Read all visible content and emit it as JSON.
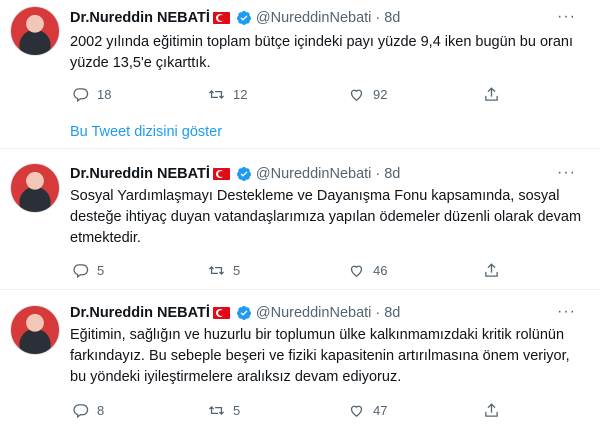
{
  "tweets": [
    {
      "name": "Dr.Nureddin NEBATİ",
      "handle": "@NureddinNebati",
      "time": "8d",
      "separator": "·",
      "more": "···",
      "text": "2002 yılında eğitimin toplam bütçe içindeki payı yüzde 9,4 iken bugün bu oranı yüzde 13,5'e çıkarttık.",
      "replies": "18",
      "retweets": "12",
      "likes": "92"
    },
    {
      "name": "Dr.Nureddin NEBATİ",
      "handle": "@NureddinNebati",
      "time": "8d",
      "separator": "·",
      "more": "···",
      "text": "Sosyal Yardımlaşmayı Destekleme ve Dayanışma Fonu kapsamında, sosyal desteğe ihtiyaç duyan vatandaşlarımıza yapılan ödemeler düzenli olarak devam etmektedir.",
      "replies": "5",
      "retweets": "5",
      "likes": "46"
    },
    {
      "name": "Dr.Nureddin NEBATİ",
      "handle": "@NureddinNebati",
      "time": "8d",
      "separator": "·",
      "more": "···",
      "text": "Eğitimin, sağlığın ve huzurlu bir toplumun ülke kalkınmamızdaki kritik rolünün farkındayız. Bu sebeple beşeri ve fiziki kapasitenin artırılmasına önem veriyor, bu yöndeki iyileştirmelere aralıksız devam ediyoruz.",
      "replies": "8",
      "retweets": "5",
      "likes": "47"
    }
  ],
  "show_thread": "Bu Tweet dizisini göster",
  "colors": {
    "accent": "#1d9bf0",
    "muted": "#536471",
    "flag_red": "#e30a17"
  },
  "icons": [
    "verified-badge-icon",
    "reply-icon",
    "retweet-icon",
    "like-icon",
    "share-icon",
    "turkish-flag-icon",
    "more-icon"
  ]
}
